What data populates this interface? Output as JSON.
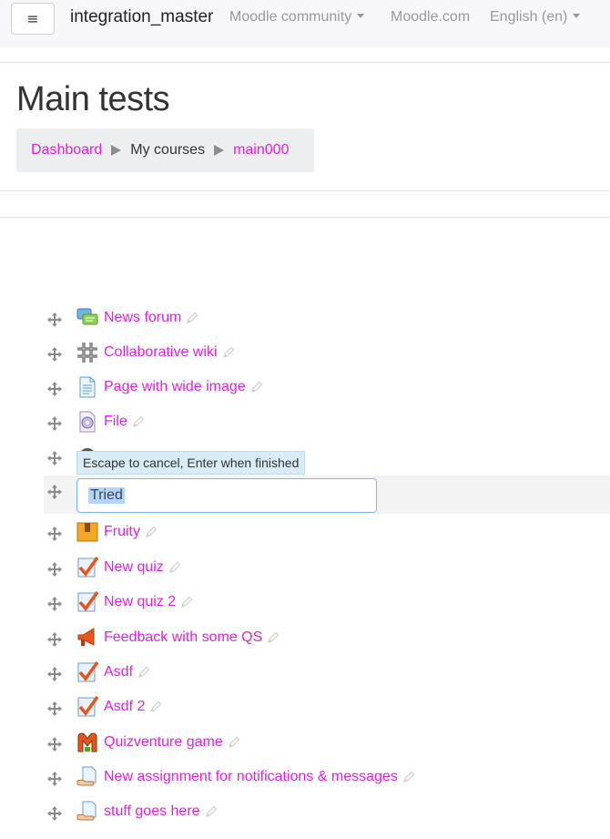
{
  "navbar": {
    "menu_icon": "≡",
    "site_name": "integration_master",
    "links": [
      {
        "label": "Moodle community",
        "dropdown": true
      },
      {
        "label": "Moodle.com",
        "dropdown": false
      },
      {
        "label": "English (en)",
        "dropdown": true
      }
    ]
  },
  "page": {
    "title": "Main tests"
  },
  "breadcrumb": [
    {
      "label": "Dashboard",
      "link": true
    },
    {
      "label": "My courses",
      "link": false
    },
    {
      "label": "main000",
      "link": true
    }
  ],
  "editing": {
    "tooltip": "Escape to cancel, Enter when finished",
    "input_value": "Tried"
  },
  "activities": [
    {
      "name": "News forum",
      "icon": "forum-icon"
    },
    {
      "name": "Collaborative wiki",
      "icon": "wiki-icon"
    },
    {
      "name": "Page with wide image",
      "icon": "page-icon"
    },
    {
      "name": "File",
      "icon": "file-icon"
    },
    {
      "name": "",
      "icon": "url-icon"
    },
    {
      "name": "Tried",
      "icon": "edit-row"
    },
    {
      "name": "Fruity",
      "icon": "database-icon"
    },
    {
      "name": "New quiz",
      "icon": "quiz-icon"
    },
    {
      "name": "New quiz 2",
      "icon": "quiz-icon"
    },
    {
      "name": "Feedback with some QS",
      "icon": "feedback-icon"
    },
    {
      "name": "Asdf",
      "icon": "quiz-icon"
    },
    {
      "name": "Asdf 2",
      "icon": "quiz-icon"
    },
    {
      "name": "Quizventure game",
      "icon": "game-icon"
    },
    {
      "name": "New assignment for notifications & messages",
      "icon": "assignment-icon"
    },
    {
      "name": "stuff goes here",
      "icon": "assignment-icon"
    }
  ],
  "colors": {
    "link": "#e020e0",
    "navbar_bg": "#f7f7f9",
    "breadcrumb_bg": "#eceeef",
    "tooltip_bg": "#d7ecf7",
    "selection": "#b3d4fc"
  }
}
